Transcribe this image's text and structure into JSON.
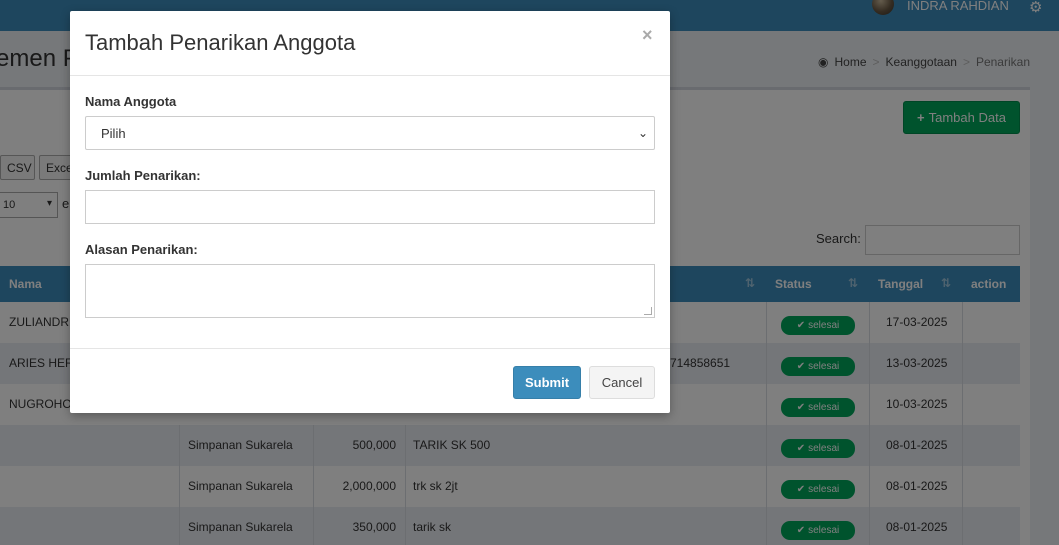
{
  "navbar": {
    "user_name": "INDRA RAHDIAN"
  },
  "content": {
    "title": "emen P",
    "breadcrumb": [
      "Home",
      "Keanggotaan",
      "Penarikan"
    ]
  },
  "toolbar": {
    "add_label": "Tambah Data",
    "export_buttons": [
      "CSV",
      "Exce"
    ],
    "length_value": "10",
    "length_suffix": "e",
    "search_label": "Search:"
  },
  "table": {
    "headers": {
      "nama": "Nama",
      "status": "Status",
      "tanggal": "Tanggal",
      "action": "action"
    },
    "rows": [
      {
        "nama": "ZULIANDRE",
        "jenis": "",
        "jumlah": "",
        "alasan": "",
        "status": "selesai",
        "tanggal": "17-03-2025"
      },
      {
        "nama": "ARIES HERM",
        "jenis": "",
        "jumlah": "",
        "alasan": "714858651",
        "status": "selesai",
        "tanggal": "13-03-2025"
      },
      {
        "nama": "NUGROHO",
        "jenis": "",
        "jumlah": "",
        "alasan": "",
        "status": "selesai",
        "tanggal": "10-03-2025"
      },
      {
        "nama": "",
        "jenis": "Simpanan Sukarela",
        "jumlah": "500,000",
        "alasan": "TARIK SK 500",
        "status": "selesai",
        "tanggal": "08-01-2025"
      },
      {
        "nama": "",
        "jenis": "Simpanan Sukarela",
        "jumlah": "2,000,000",
        "alasan": "trk sk 2jt",
        "status": "selesai",
        "tanggal": "08-01-2025"
      },
      {
        "nama": "",
        "jenis": "Simpanan Sukarela",
        "jumlah": "350,000",
        "alasan": "tarik sk",
        "status": "selesai",
        "tanggal": "08-01-2025"
      }
    ]
  },
  "modal": {
    "title": "Tambah Penarikan Anggota",
    "close": "×",
    "nama_label": "Nama Anggota",
    "nama_selected": "Pilih",
    "jumlah_label": "Jumlah Penarikan:",
    "alasan_label": "Alasan Penarikan:",
    "submit_label": "Submit",
    "cancel_label": "Cancel"
  },
  "colors": {
    "primary": "#3c8dbc",
    "success": "#00a65a"
  },
  "icons": [
    "gears-icon",
    "dashboard-icon",
    "plus-icon",
    "check-icon",
    "sort-icon",
    "close-icon",
    "chevron-down-icon"
  ]
}
